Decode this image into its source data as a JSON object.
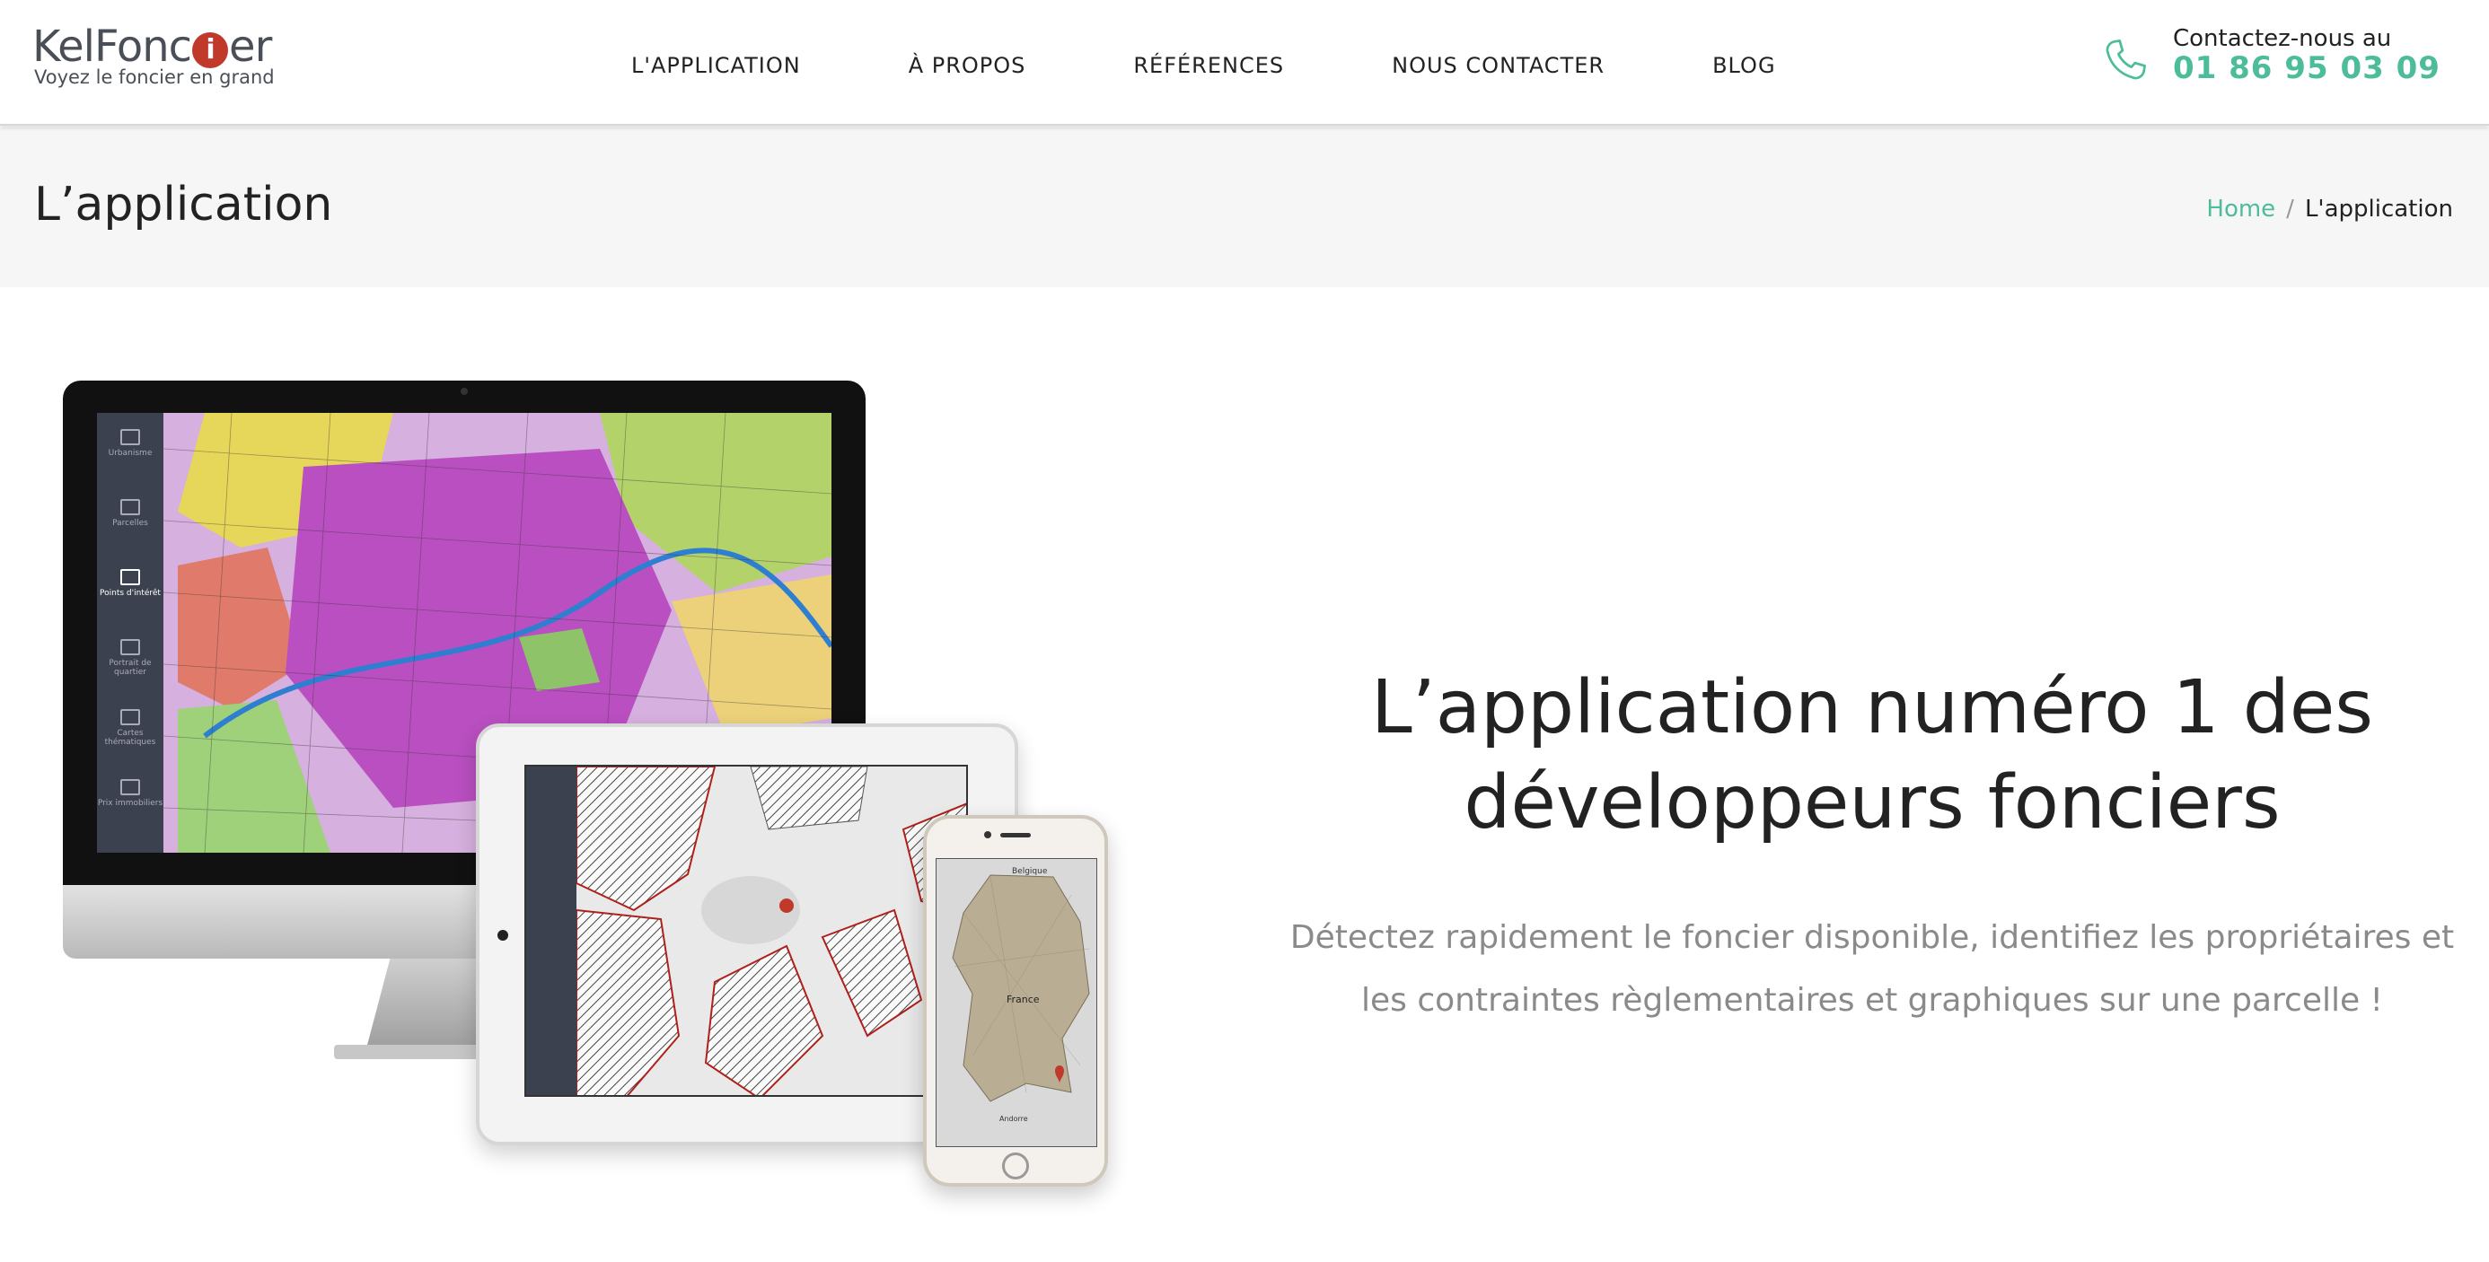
{
  "header": {
    "logo": {
      "word_pre": "KelFonc",
      "word_i": "i",
      "word_post": "er",
      "tagline": "Voyez le foncier en grand"
    },
    "nav": [
      {
        "label": "L'APPLICATION"
      },
      {
        "label": "À PROPOS"
      },
      {
        "label": "RÉFÉRENCES"
      },
      {
        "label": "NOUS CONTACTER"
      },
      {
        "label": "BLOG"
      }
    ],
    "contact": {
      "label": "Contactez-nous au",
      "phone": "01 86 95 03 09",
      "icon": "phone-icon"
    }
  },
  "titlebar": {
    "title": "L’application",
    "breadcrumb": {
      "home": "Home",
      "separator": "/",
      "current": "L'application"
    }
  },
  "devices": {
    "sidebar_labels": [
      "Urbanisme",
      "Parcelles",
      "Points d'intérêt",
      "Portrait de quartier",
      "Cartes thématiques",
      "Prix immobiliers"
    ],
    "phone_map_labels": [
      "Belgique",
      "France",
      "Andorre"
    ]
  },
  "hero": {
    "title": "L’application numéro 1 des développeurs fonciers",
    "subtitle": "Détectez rapidement le foncier disponible, identifiez les propriétaires et les contraintes règlementaires et graphiques sur une parcelle !"
  },
  "colors": {
    "accent": "#4cbc9a",
    "logo_red": "#c0392b",
    "text": "#222222",
    "muted": "#8a8a8a",
    "titlebar_bg": "#f6f6f6"
  }
}
